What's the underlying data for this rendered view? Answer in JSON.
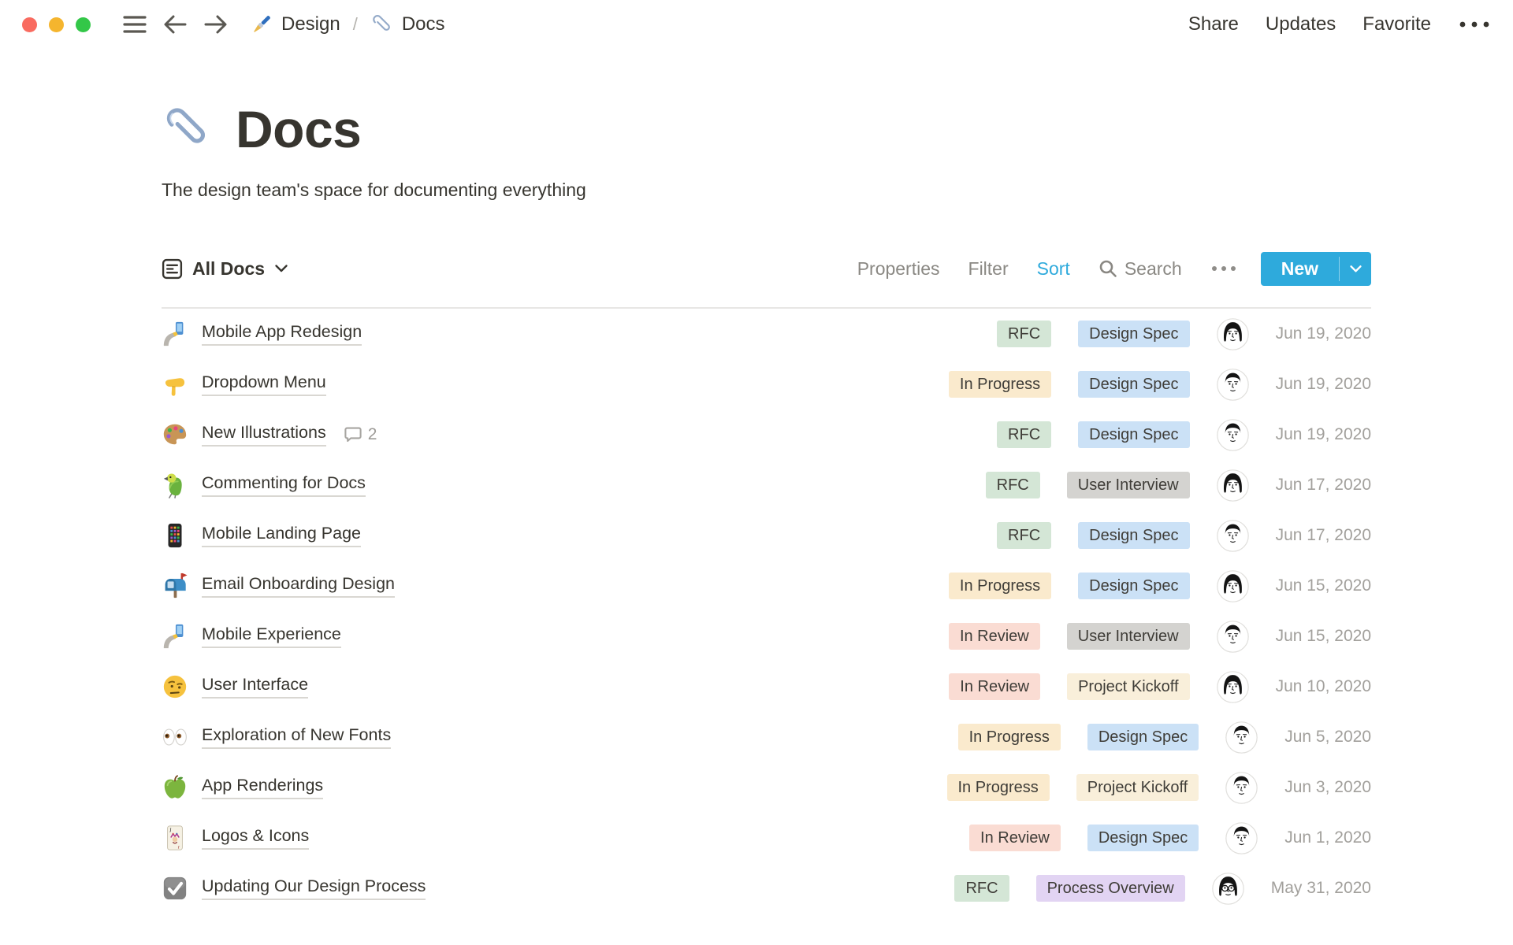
{
  "colors": {
    "accent_blue": "#2EAADC",
    "tags": {
      "green": "#D4E6D6",
      "blue": "#CBE1F6",
      "yellow": "#FAEACD",
      "cream": "#F9EFDA",
      "pink": "#FADCD3",
      "gray": "#D4D3D0",
      "purple": "#E2D4F3"
    }
  },
  "titlebar": {
    "breadcrumb": [
      {
        "icon": "paintbrush-emoji",
        "label": "Design"
      },
      {
        "icon": "paperclip-emoji",
        "label": "Docs"
      }
    ],
    "separator": "/",
    "actions": [
      {
        "label": "Share"
      },
      {
        "label": "Updates"
      },
      {
        "label": "Favorite"
      }
    ]
  },
  "page": {
    "icon": "paperclip-emoji",
    "title": "Docs",
    "description": "The design team's space for documenting everything"
  },
  "toolbar": {
    "view_name": "All Docs",
    "properties_label": "Properties",
    "filter_label": "Filter",
    "sort_label": "Sort",
    "search_label": "Search",
    "new_label": "New"
  },
  "docs": [
    {
      "icon": "selfie",
      "emoji": "🤳",
      "title": "Mobile App Redesign",
      "comment_count": null,
      "status": "RFC",
      "status_color": "green",
      "type": "Design Spec",
      "type_color": "blue",
      "owner_avatar": "woman",
      "date": "Jun 19, 2020"
    },
    {
      "icon": "point-down",
      "emoji": "👇",
      "title": "Dropdown Menu",
      "comment_count": null,
      "status": "In Progress",
      "status_color": "yellow",
      "type": "Design Spec",
      "type_color": "blue",
      "owner_avatar": "man",
      "date": "Jun 19, 2020"
    },
    {
      "icon": "artist-palette",
      "emoji": "🎨",
      "title": "New Illustrations",
      "comment_count": 2,
      "status": "RFC",
      "status_color": "green",
      "type": "Design Spec",
      "type_color": "blue",
      "owner_avatar": "man",
      "date": "Jun 19, 2020"
    },
    {
      "icon": "parrot",
      "emoji": "🦜",
      "title": "Commenting for Docs",
      "comment_count": null,
      "status": "RFC",
      "status_color": "green",
      "type": "User Interview",
      "type_color": "gray",
      "owner_avatar": "woman",
      "date": "Jun 17, 2020"
    },
    {
      "icon": "mobile-phone",
      "emoji": "📱",
      "title": "Mobile Landing Page",
      "comment_count": null,
      "status": "RFC",
      "status_color": "green",
      "type": "Design Spec",
      "type_color": "blue",
      "owner_avatar": "man",
      "date": "Jun 17, 2020"
    },
    {
      "icon": "mailbox",
      "emoji": "📬",
      "title": "Email Onboarding Design",
      "comment_count": null,
      "status": "In Progress",
      "status_color": "yellow",
      "type": "Design Spec",
      "type_color": "blue",
      "owner_avatar": "woman",
      "date": "Jun 15, 2020"
    },
    {
      "icon": "selfie",
      "emoji": "🤳",
      "title": "Mobile Experience",
      "comment_count": null,
      "status": "In Review",
      "status_color": "pink",
      "type": "User Interview",
      "type_color": "gray",
      "owner_avatar": "man",
      "date": "Jun 15, 2020"
    },
    {
      "icon": "raised-eyebrow",
      "emoji": "🤨",
      "title": "User Interface",
      "comment_count": null,
      "status": "In Review",
      "status_color": "pink",
      "type": "Project Kickoff",
      "type_color": "cream",
      "owner_avatar": "woman",
      "date": "Jun 10, 2020"
    },
    {
      "icon": "eyes",
      "emoji": "👀",
      "title": "Exploration of New Fonts",
      "comment_count": null,
      "status": "In Progress",
      "status_color": "yellow",
      "type": "Design Spec",
      "type_color": "blue",
      "owner_avatar": "man",
      "date": "Jun 5, 2020"
    },
    {
      "icon": "green-apple",
      "emoji": "🍏",
      "title": "App Renderings",
      "comment_count": null,
      "status": "In Progress",
      "status_color": "yellow",
      "type": "Project Kickoff",
      "type_color": "cream",
      "owner_avatar": "man",
      "date": "Jun 3, 2020"
    },
    {
      "icon": "joker-card",
      "emoji": "🃏",
      "title": "Logos & Icons",
      "comment_count": null,
      "status": "In Review",
      "status_color": "pink",
      "type": "Design Spec",
      "type_color": "blue",
      "owner_avatar": "man",
      "date": "Jun 1, 2020"
    },
    {
      "icon": "check-box",
      "emoji": "☑️",
      "title": "Updating Our Design Process",
      "comment_count": null,
      "status": "RFC",
      "status_color": "green",
      "type": "Process Overview",
      "type_color": "purple",
      "owner_avatar": "glasses",
      "date": "May 31, 2020"
    }
  ]
}
